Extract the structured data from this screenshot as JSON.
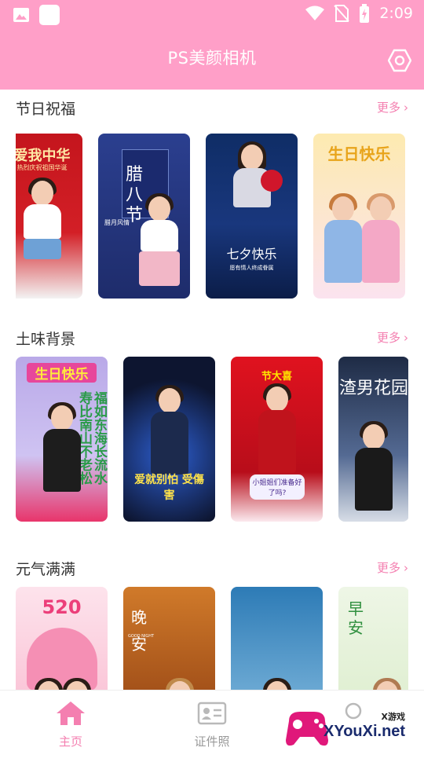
{
  "status": {
    "time": "2:09"
  },
  "app": {
    "title": "PS美颜相机"
  },
  "sections": [
    {
      "title": "节日祝福",
      "more": "更多",
      "cards": [
        {
          "text": "爱我中华",
          "sub": "热烈庆祝祖国华诞"
        },
        {
          "text": "腊八节",
          "sub": "腊月风情"
        },
        {
          "text": "七夕快乐",
          "sub": "愿有情人终成眷属"
        },
        {
          "text": "生日快乐",
          "sub": ""
        }
      ]
    },
    {
      "title": "土味背景",
      "more": "更多",
      "cards": [
        {
          "text": "生日快乐",
          "sub": "福如东海长流水 寿比南山不老松"
        },
        {
          "text": "爱就别怕 受傷害",
          "sub": ""
        },
        {
          "text": "节大喜",
          "sub": "小姐姐们准备好了吗?"
        },
        {
          "text": "渣男花园",
          "sub": ""
        }
      ]
    },
    {
      "title": "元气满满",
      "more": "更多",
      "cards": [
        {
          "text": "520",
          "sub": ""
        },
        {
          "text": "晚安",
          "sub": "GOOD NIGHT"
        },
        {
          "text": "",
          "sub": ""
        },
        {
          "text": "早安",
          "sub": ""
        }
      ]
    }
  ],
  "nav": {
    "home": "主页",
    "id_photo": "证件照"
  },
  "watermark": {
    "brand": "XYouXi.net",
    "tag": "X游戏"
  },
  "colors": {
    "pink": "#ff9fc8",
    "accent": "#f47fb0"
  }
}
